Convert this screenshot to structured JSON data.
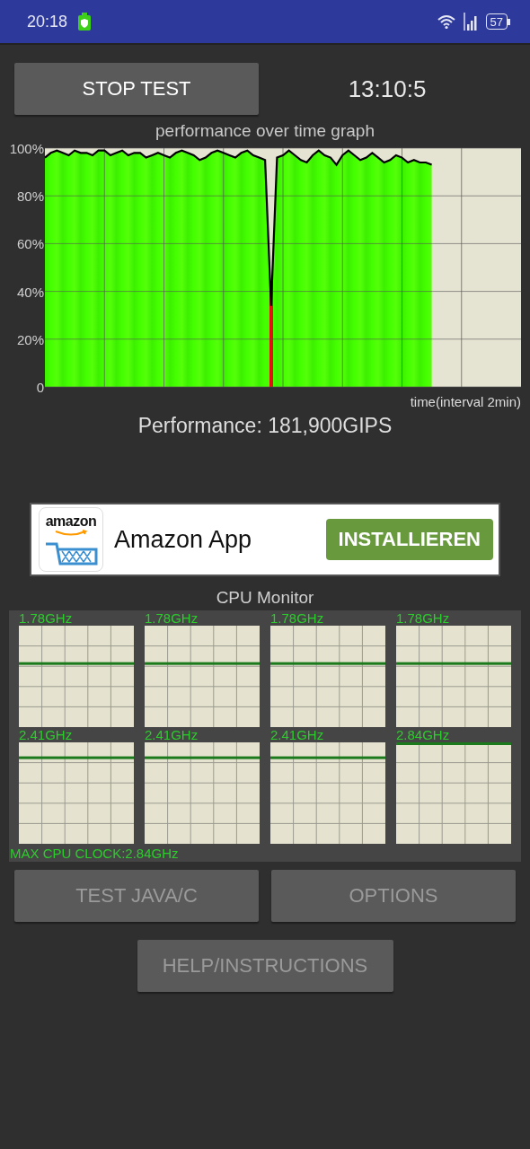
{
  "status_bar": {
    "time": "20:18",
    "battery": "57"
  },
  "stop_button": {
    "label": "STOP TEST",
    "disabled": false
  },
  "timer": "13:10:5",
  "performance_graph": {
    "chart_data": {
      "type": "area",
      "title": "performance over time graph",
      "xlabel": "time(interval 2min)",
      "ylim": [
        0,
        100
      ],
      "grid": true,
      "yticks": [
        {
          "value": 0,
          "label": "0"
        },
        {
          "value": 20,
          "label": "20%"
        },
        {
          "value": 40,
          "label": "40%"
        },
        {
          "value": 60,
          "label": "60%"
        },
        {
          "value": 80,
          "label": "80%"
        },
        {
          "value": 100,
          "label": "100%"
        }
      ],
      "series": [
        {
          "color": "#44ff00",
          "values": [
            96,
            98,
            99,
            98,
            97,
            99,
            98,
            98,
            97,
            99,
            99,
            97,
            98,
            99,
            97,
            98,
            98,
            96,
            97,
            98,
            97,
            96,
            98,
            99,
            98,
            97,
            95,
            96,
            98,
            99,
            98,
            97,
            96,
            98,
            99,
            97,
            96,
            95,
            34,
            96,
            97,
            99,
            97,
            95,
            94,
            97,
            99,
            97,
            96,
            93,
            97,
            99,
            97,
            95,
            96,
            98,
            96,
            94,
            95,
            97,
            96,
            94,
            95,
            94,
            94,
            93,
            null,
            null,
            null,
            null,
            null,
            null,
            null,
            null,
            null,
            null,
            null,
            null,
            null,
            null,
            null
          ]
        }
      ]
    }
  },
  "performance": "Performance: 181,900GIPS",
  "ad": {
    "icon_text": "amazon",
    "title": "Amazon App",
    "button": "INSTALLIEREN"
  },
  "cpu_monitor": {
    "title": "CPU Monitor",
    "cores": [
      {
        "frequency": "1.78GHz"
      },
      {
        "frequency": "1.78GHz"
      },
      {
        "frequency": "1.78GHz"
      },
      {
        "frequency": "1.78GHz"
      },
      {
        "frequency": "2.41GHz"
      },
      {
        "frequency": "2.41GHz"
      },
      {
        "frequency": "2.41GHz"
      },
      {
        "frequency": "2.84GHz"
      }
    ],
    "max_clock": "MAX CPU CLOCK:2.84GHz"
  },
  "buttons": [
    {
      "label": "TEST JAVA/C",
      "disabled": true
    },
    {
      "label": "OPTIONS",
      "disabled": true
    }
  ],
  "help_button": {
    "label": "HELP/INSTRUCTIONS",
    "disabled": true
  }
}
